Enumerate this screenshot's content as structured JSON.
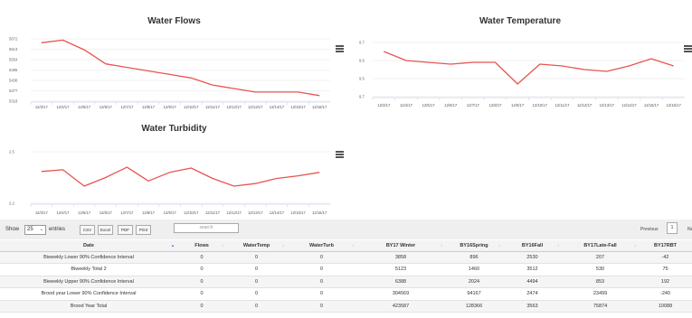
{
  "charts": [
    {
      "title": "Water Flows",
      "type": "line",
      "categories": [
        "12/3/17",
        "12/4/17",
        "12/5/17",
        "12/6/17",
        "12/7/17",
        "12/8/17",
        "12/9/17",
        "12/10/17",
        "12/11/17",
        "12/12/17",
        "12/13/17",
        "12/14/17",
        "12/15/17",
        "12/16/17"
      ],
      "y_ticks": [
        "5672",
        "5613",
        "5554",
        "5495",
        "5436",
        "5377",
        "5318"
      ],
      "values": [
        5650,
        5665,
        5610,
        5530,
        5510,
        5490,
        5470,
        5450,
        5410,
        5390,
        5370,
        5370,
        5370,
        5350
      ],
      "ylim": [
        5318,
        5672
      ],
      "line_color": "#e8544f"
    },
    {
      "title": "Water Temperature",
      "type": "line",
      "categories": [
        "12/3/17",
        "12/4/17",
        "12/5/17",
        "12/6/17",
        "12/7/17",
        "12/8/17",
        "12/9/17",
        "12/10/17",
        "12/11/17",
        "12/12/17",
        "12/13/17",
        "12/14/17",
        "12/15/17",
        "12/16/17"
      ],
      "y_ticks": [
        "9.7",
        "9.6",
        "9.5",
        "9.7"
      ],
      "values": [
        9.65,
        9.6,
        9.59,
        9.58,
        9.59,
        9.59,
        9.47,
        9.58,
        9.57,
        9.55,
        9.54,
        9.57,
        9.61,
        9.57
      ],
      "ylim": [
        9.4,
        9.7
      ],
      "line_color": "#e8544f"
    },
    {
      "title": "Water Turbidity",
      "type": "line",
      "categories": [
        "12/3/17",
        "12/4/17",
        "12/5/17",
        "12/6/17",
        "12/7/17",
        "12/8/17",
        "12/9/17",
        "12/10/17",
        "12/11/17",
        "12/12/17",
        "12/13/17",
        "12/14/17",
        "12/15/17",
        "12/16/17"
      ],
      "y_ticks": [
        "2.5",
        "2.2"
      ],
      "values": [
        2.42,
        2.44,
        2.25,
        2.35,
        2.47,
        2.31,
        2.41,
        2.46,
        2.34,
        2.25,
        2.28,
        2.34,
        2.37,
        2.41
      ],
      "ylim": [
        2.05,
        2.65
      ],
      "line_color": "#e8544f"
    }
  ],
  "controls": {
    "show_label": "Show",
    "entries_value": "25",
    "entries_label": "entries",
    "buttons": [
      "CSV",
      "Excel",
      "PDF",
      "Print"
    ],
    "search_placeholder": "search",
    "previous_label": "Previous",
    "page_number": "1",
    "next_label": "Ne"
  },
  "table": {
    "headers": [
      "Date",
      "Flows",
      "WaterTemp",
      "WaterTurb",
      "BY17 Winter",
      "BY16Spring",
      "BY16Fall",
      "BY17Late-Fall",
      "BY17RBT"
    ],
    "rows": [
      [
        "Biweekly Lower 90% Confidence Interval",
        "0",
        "0",
        "0",
        "3858",
        "896",
        "2530",
        "207",
        "-42"
      ],
      [
        "Biweekly Total 2",
        "0",
        "0",
        "0",
        "5123",
        "1460",
        "3512",
        "530",
        "75"
      ],
      [
        "Biweekly Upper 90% Confidence Interval",
        "0",
        "0",
        "0",
        "6388",
        "2024",
        "4494",
        "853",
        "192"
      ],
      [
        "Brood year Lower 90% Confidence Interval",
        "0",
        "0",
        "0",
        "304569",
        "94167",
        "2474",
        "23499",
        "-240"
      ],
      [
        "Brood Year Total",
        "0",
        "0",
        "0",
        "423587",
        "128366",
        "3563",
        "75874",
        "10088"
      ]
    ]
  }
}
